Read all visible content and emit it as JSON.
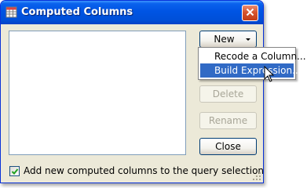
{
  "window": {
    "title": "Computed Columns"
  },
  "buttons": {
    "new": "New",
    "delete": "Delete",
    "rename": "Rename",
    "close": "Close"
  },
  "menu": {
    "items": [
      {
        "label": "Recode a Column..."
      },
      {
        "label": "Build Expression..."
      }
    ]
  },
  "checkbox": {
    "label": "Add new computed columns to the query selection",
    "checked": true
  },
  "colors": {
    "titlebar": "#0054e3",
    "dialog_bg": "#ece9d8",
    "menu_highlight": "#316ac5",
    "close_button": "#d7552f"
  },
  "icons": {
    "title_icon": "table-icon",
    "close": "close-icon",
    "dropdown": "chevron-down-icon",
    "checkmark": "check-icon",
    "cursor": "arrow-cursor-icon",
    "grip": "resize-grip-icon"
  }
}
